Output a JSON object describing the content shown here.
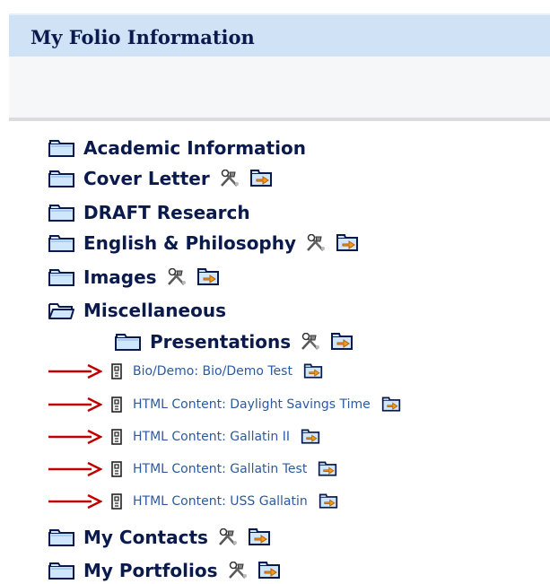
{
  "header": {
    "title": "My Folio Information"
  },
  "folders_top": [
    {
      "label": "Academic Information",
      "icon": "folder-closed-icon",
      "has_tools": false,
      "has_share": false
    },
    {
      "label": "Cover Letter",
      "icon": "folder-closed-icon",
      "has_tools": true,
      "has_share": true
    },
    {
      "label": "DRAFT Research",
      "icon": "folder-closed-icon",
      "has_tools": false,
      "has_share": false
    },
    {
      "label": "English & Philosophy",
      "icon": "folder-closed-icon",
      "has_tools": true,
      "has_share": true
    },
    {
      "label": "Images",
      "icon": "folder-closed-icon",
      "has_tools": true,
      "has_share": true
    },
    {
      "label": "Miscellaneous",
      "icon": "folder-open-icon",
      "has_tools": false,
      "has_share": false
    }
  ],
  "subfolder": {
    "label": "Presentations",
    "icon": "folder-closed-icon"
  },
  "files": [
    {
      "label": "Bio/Demo: Bio/Demo Test"
    },
    {
      "label": "HTML Content: Daylight Savings Time"
    },
    {
      "label": "HTML Content: Gallatin II"
    },
    {
      "label": "HTML Content: Gallatin Test"
    },
    {
      "label": "HTML Content: USS Gallatin"
    }
  ],
  "folders_bottom": [
    {
      "label": "My Contacts",
      "icon": "folder-closed-icon",
      "has_tools": true,
      "has_share": true
    },
    {
      "label": "My Portfolios",
      "icon": "folder-closed-icon",
      "has_tools": true,
      "has_share": true
    }
  ],
  "colors": {
    "header_bar": "#cfe2f6",
    "folder_text": "#0a1a4d",
    "file_text": "#2c5aa0",
    "arrow": "#c00000"
  }
}
